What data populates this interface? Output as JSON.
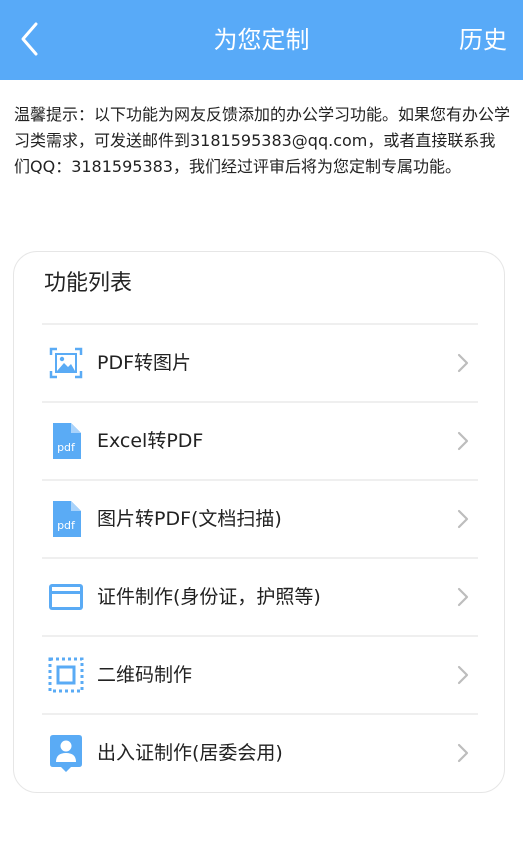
{
  "header": {
    "title": "为您定制",
    "history_label": "历史",
    "bg_color": "#58aaf8"
  },
  "notice": {
    "text": "温馨提示：以下功能为网友反馈添加的办公学习功能。如果您有办公学习类需求，可发送邮件到3181595383@qq.com，或者直接联系我们QQ：3181595383，我们经过评审后将为您定制专属功能。"
  },
  "card": {
    "title": "功能列表",
    "items": [
      {
        "label": "PDF转图片",
        "icon": "image-icon"
      },
      {
        "label": "Excel转PDF",
        "icon": "pdf-file-icon"
      },
      {
        "label": "图片转PDF(文档扫描)",
        "icon": "pdf-file-icon"
      },
      {
        "label": "证件制作(身份证，护照等)",
        "icon": "card-icon"
      },
      {
        "label": "二维码制作",
        "icon": "qr-frame-icon"
      },
      {
        "label": "出入证制作(居委会用)",
        "icon": "person-badge-icon"
      }
    ],
    "icon_color": "#5aabf5"
  }
}
